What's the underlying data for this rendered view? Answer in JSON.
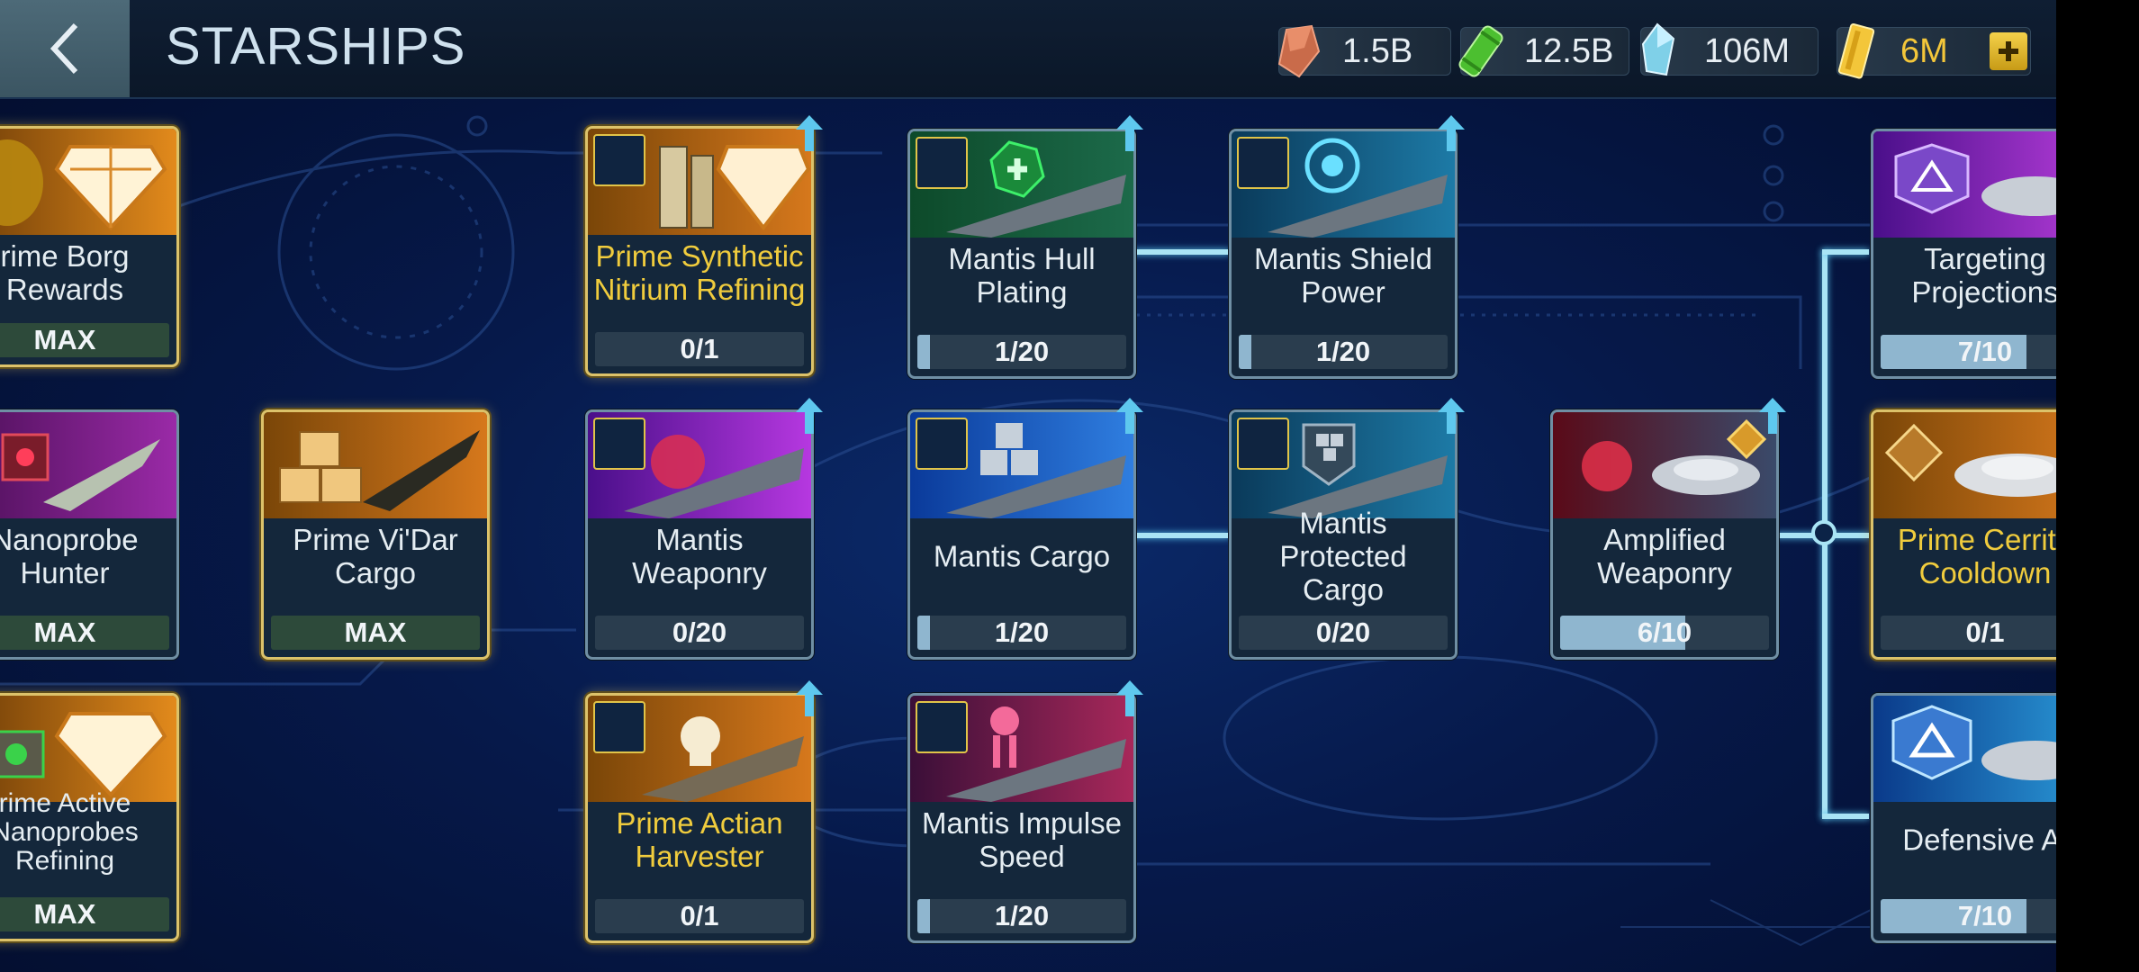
{
  "header": {
    "title": "STARSHIPS",
    "resources": [
      {
        "name": "parsteel",
        "value": "1.5B",
        "icon": "parsteel-crystal-icon",
        "color": "#c96b4a"
      },
      {
        "name": "tritanium",
        "value": "12.5B",
        "icon": "tritanium-cylinder-icon",
        "color": "#5cc83a"
      },
      {
        "name": "dilithium",
        "value": "106M",
        "icon": "dilithium-crystal-icon",
        "color": "#7fd0e8"
      },
      {
        "name": "latinum",
        "value": "6M",
        "icon": "gold-latinum-icon",
        "color": "#f3c63a"
      }
    ]
  },
  "cards": [
    {
      "id": "prime-borg-rewards",
      "name": "rime Borg\nRewards",
      "progress": "MAX",
      "fill": 1.0,
      "style": "gold"
    },
    {
      "id": "nanoprobe-hunter",
      "name": "Nanoprobe\nHunter",
      "progress": "MAX",
      "fill": 1.0,
      "style": "plain"
    },
    {
      "id": "prime-active-nanoprobes-refining",
      "name": "rime Active\nNanoprobes\nRefining",
      "progress": "MAX",
      "fill": 1.0,
      "style": "gold"
    },
    {
      "id": "prime-vidar-cargo",
      "name": "Prime Vi'Dar\nCargo",
      "progress": "MAX",
      "fill": 1.0,
      "style": "gold"
    },
    {
      "id": "prime-synthetic-nitrium-refining",
      "name": "Prime Synthetic\nNitrium Refining",
      "progress": "0/1",
      "fill": 0.0,
      "style": "gold"
    },
    {
      "id": "mantis-weaponry",
      "name": "Mantis\nWeaponry",
      "progress": "0/20",
      "fill": 0.0,
      "style": "plain"
    },
    {
      "id": "prime-actian-harvester",
      "name": "Prime Actian\nHarvester",
      "progress": "0/1",
      "fill": 0.0,
      "style": "gold"
    },
    {
      "id": "mantis-hull-plating",
      "name": "Mantis Hull\nPlating",
      "progress": "1/20",
      "fill": 0.05,
      "style": "plain"
    },
    {
      "id": "mantis-cargo",
      "name": "Mantis Cargo",
      "progress": "1/20",
      "fill": 0.05,
      "style": "plain"
    },
    {
      "id": "mantis-impulse-speed",
      "name": "Mantis Impulse\nSpeed",
      "progress": "1/20",
      "fill": 0.05,
      "style": "plain"
    },
    {
      "id": "mantis-shield-power",
      "name": "Mantis Shield\nPower",
      "progress": "1/20",
      "fill": 0.05,
      "style": "plain"
    },
    {
      "id": "mantis-protected-cargo",
      "name": "Mantis\nProtected Cargo",
      "progress": "0/20",
      "fill": 0.0,
      "style": "plain"
    },
    {
      "id": "amplified-weaponry",
      "name": "Amplified\nWeaponry",
      "progress": "6/10",
      "fill": 0.6,
      "style": "plain"
    },
    {
      "id": "targeting-projections",
      "name": "Targeting\nProjections",
      "progress": "7/10",
      "fill": 0.7,
      "style": "plain"
    },
    {
      "id": "prime-cerritos-cooldown",
      "name": "Prime Cerrito\nCooldown",
      "progress": "0/1",
      "fill": 0.0,
      "style": "gold"
    },
    {
      "id": "defensive-ai",
      "name": "Defensive Ai",
      "progress": "7/10",
      "fill": 0.7,
      "style": "plain"
    }
  ]
}
